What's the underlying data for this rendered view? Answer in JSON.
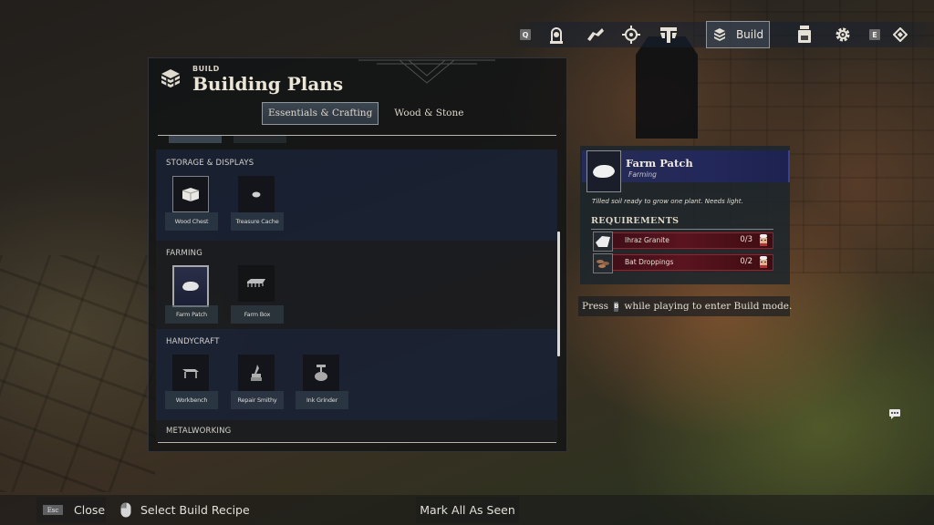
{
  "topnav": {
    "items": [
      {
        "key": "Q",
        "icon": "q-key"
      },
      {
        "icon": "gate-portal-icon"
      },
      {
        "icon": "scroll-map-icon"
      },
      {
        "icon": "compass-icon"
      },
      {
        "icon": "skills-tree-icon"
      },
      {
        "icon": "build-icon",
        "label": "Build",
        "active": true
      },
      {
        "icon": "backpack-icon"
      },
      {
        "icon": "gear-icon"
      },
      {
        "key": "E",
        "icon": "e-key"
      },
      {
        "icon": "diamond-icon"
      }
    ],
    "build_label": "Build",
    "q_key": "Q",
    "e_key": "E"
  },
  "panel": {
    "kicker": "BUILD",
    "title": "Building Plans",
    "tabs": [
      {
        "label": "Essentials & Crafting",
        "active": true
      },
      {
        "label": "Wood & Stone",
        "active": false
      }
    ],
    "sections": [
      {
        "title": "STORAGE & DISPLAYS",
        "items": [
          {
            "label": "Wood Chest",
            "icon": "wood-chest-icon"
          },
          {
            "label": "Treasure Cache",
            "icon": "treasure-cache-icon"
          }
        ]
      },
      {
        "title": "FARMING",
        "items": [
          {
            "label": "Farm Patch",
            "icon": "farm-patch-icon",
            "selected": true
          },
          {
            "label": "Farm Box",
            "icon": "farm-box-icon"
          }
        ]
      },
      {
        "title": "HANDYCRAFT",
        "items": [
          {
            "label": "Workbench",
            "icon": "workbench-icon"
          },
          {
            "label": "Repair Smithy",
            "icon": "repair-smithy-icon"
          },
          {
            "label": "Ink Grinder",
            "icon": "ink-grinder-icon"
          }
        ]
      },
      {
        "title": "METALWORKING",
        "items": []
      }
    ]
  },
  "detail": {
    "name": "Farm Patch",
    "category": "Farming",
    "description": "Tilled soil ready to grow one plant. Needs light.",
    "requirements_title": "REQUIREMENTS",
    "requirements": [
      {
        "name": "Ihraz Granite",
        "count": "0/3",
        "have": 0,
        "need": 3,
        "icon": "granite-icon"
      },
      {
        "name": "Bat Droppings",
        "count": "0/2",
        "have": 0,
        "need": 2,
        "icon": "bat-droppings-icon"
      }
    ],
    "accent_color": "#23285a",
    "missing_color": "#a01e2c"
  },
  "hint": {
    "prefix": "Press",
    "key": "B",
    "suffix": "while playing to enter Build mode."
  },
  "bottombar": {
    "close_key": "Esc",
    "close_label": "Close",
    "select_label": "Select Build Recipe",
    "mark_label": "Mark All As Seen"
  }
}
